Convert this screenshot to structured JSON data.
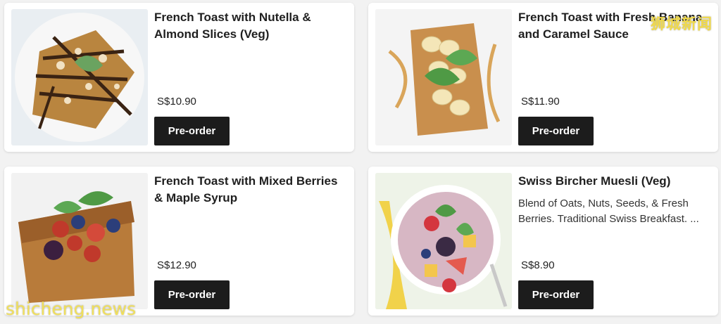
{
  "menu": {
    "items": [
      {
        "title": "French Toast with Nutella & Almond Slices (Veg)",
        "description": "",
        "price": "S$10.90",
        "button": "Pre-order"
      },
      {
        "title": "French Toast with Fresh Banana and Caramel Sauce",
        "description": "",
        "price": "S$11.90",
        "button": "Pre-order"
      },
      {
        "title": "French Toast with Mixed Berries & Maple Syrup",
        "description": "",
        "price": "S$12.90",
        "button": "Pre-order"
      },
      {
        "title": "Swiss Bircher Muesli (Veg)",
        "description": "Blend of Oats, Nuts, Seeds, & Fresh Berries. Traditional Swiss Breakfast. ...",
        "price": "S$8.90",
        "button": "Pre-order"
      }
    ]
  },
  "watermarks": {
    "top_right": "狮城新闻",
    "bottom_left": "shicheng.news"
  },
  "colors": {
    "button_bg": "#1c1c1c",
    "watermark": "#f0d94a"
  }
}
